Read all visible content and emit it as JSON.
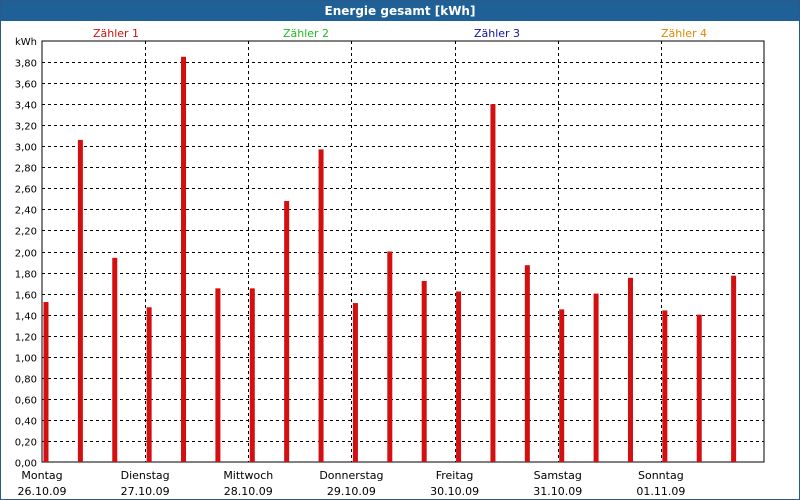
{
  "window": {
    "title": "Energie gesamt [kWh]"
  },
  "colors": {
    "bar": "#d40f0f",
    "titlebar": "#1f6196",
    "legend": [
      "#cc1111",
      "#22bb22",
      "#1111aa",
      "#dd8800"
    ]
  },
  "chart_data": {
    "type": "bar",
    "title": "Energie gesamt [kWh]",
    "ylabel": "kWh",
    "ylim": [
      0,
      4.0
    ],
    "yticks": [
      "0,00",
      "0,20",
      "0,40",
      "0,60",
      "0,80",
      "1,00",
      "1,20",
      "1,40",
      "1,60",
      "1,80",
      "2,00",
      "2,20",
      "2,40",
      "2,60",
      "2,80",
      "3,00",
      "3,20",
      "3,40",
      "3,60",
      "3,80"
    ],
    "legend": [
      "Zähler 1",
      "Zähler 2",
      "Zähler 3",
      "Zähler 4"
    ],
    "days": [
      {
        "name": "Montag",
        "date": "26.10.09"
      },
      {
        "name": "Dienstag",
        "date": "27.10.09"
      },
      {
        "name": "Mittwoch",
        "date": "28.10.09"
      },
      {
        "name": "Donnerstag",
        "date": "29.10.09"
      },
      {
        "name": "Freitag",
        "date": "30.10.09"
      },
      {
        "name": "Samstag",
        "date": "31.10.09"
      },
      {
        "name": "Sonntag",
        "date": "01.11.09"
      }
    ],
    "values": [
      1.52,
      3.06,
      1.94,
      1.47,
      3.85,
      1.65,
      1.65,
      2.48,
      2.97,
      1.51,
      2.0,
      1.72,
      1.62,
      3.4,
      1.87,
      1.45,
      1.6,
      1.75,
      1.44,
      1.4,
      1.77
    ]
  }
}
